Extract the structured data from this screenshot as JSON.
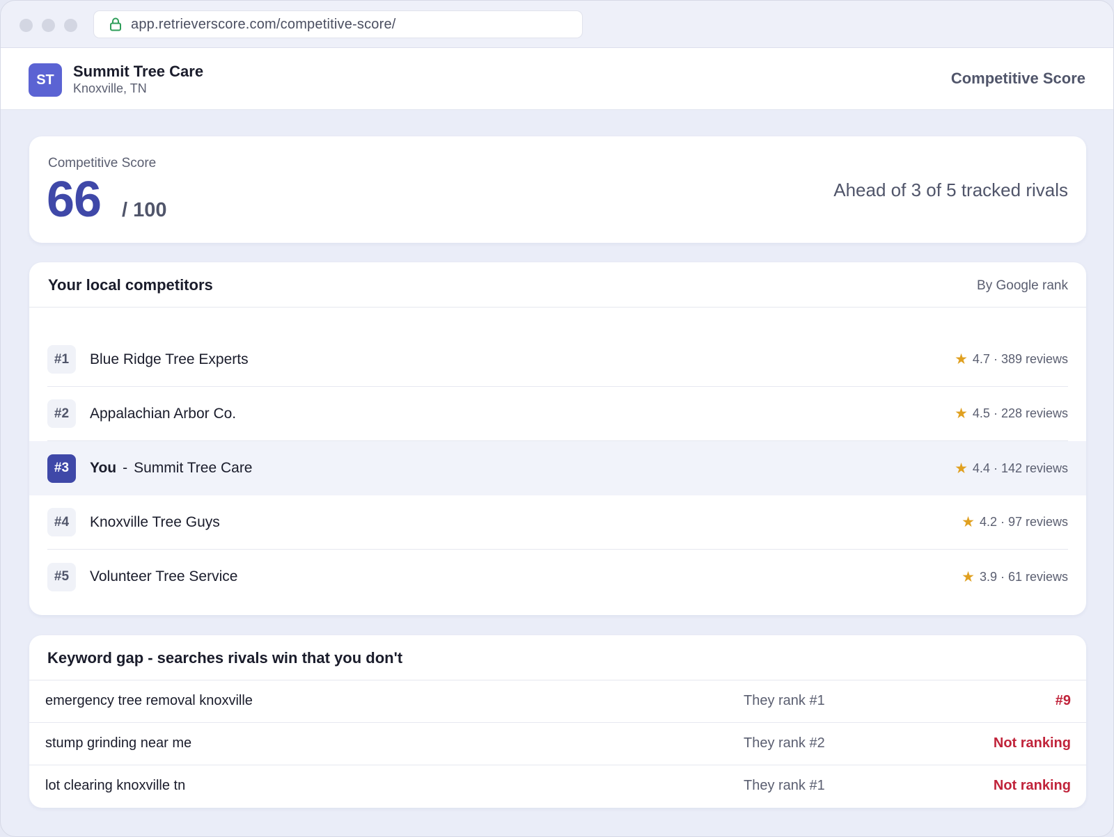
{
  "browser": {
    "url": "app.retrieverscore.com/competitive-score/"
  },
  "header": {
    "avatar_initials": "ST",
    "business_name": "Summit Tree Care",
    "location": "Knoxville, TN",
    "page_title": "Competitive Score"
  },
  "score": {
    "label": "Competitive Score",
    "value": "66",
    "max": "/ 100",
    "rivals_text": "Ahead of 3 of 5 tracked rivals"
  },
  "competitors": {
    "title": "Your local competitors",
    "sort_label": "By Google rank",
    "items": [
      {
        "rank": "#1",
        "name": "Blue Ridge Tree Experts",
        "rating": "4.7 · 389 reviews"
      },
      {
        "rank": "#2",
        "name": "Appalachian Arbor Co.",
        "rating": "4.5 · 228 reviews"
      },
      {
        "rank": "#3",
        "you_label": "You",
        "separator": "-",
        "name": "Summit Tree Care",
        "rating": "4.4 · 142 reviews"
      },
      {
        "rank": "#4",
        "name": "Knoxville Tree Guys",
        "rating": "4.2 · 97 reviews"
      },
      {
        "rank": "#5",
        "name": "Volunteer Tree Service",
        "rating": "3.9 · 61 reviews"
      }
    ]
  },
  "keyword_gap": {
    "title": "Keyword gap  -  searches rivals win that you don't",
    "rows": [
      {
        "term": "emergency tree removal knoxville",
        "them": "They rank #1",
        "you": "#9"
      },
      {
        "term": "stump grinding near me",
        "them": "They rank #2",
        "you": "Not ranking"
      },
      {
        "term": "lot clearing knoxville tn",
        "them": "They rank #1",
        "you": "Not ranking"
      }
    ]
  },
  "colors": {
    "accent": "#3f48a8",
    "star": "#e0a020",
    "negative": "#c0233a"
  },
  "icons": {
    "lock": "lock-icon",
    "star": "star-icon"
  }
}
